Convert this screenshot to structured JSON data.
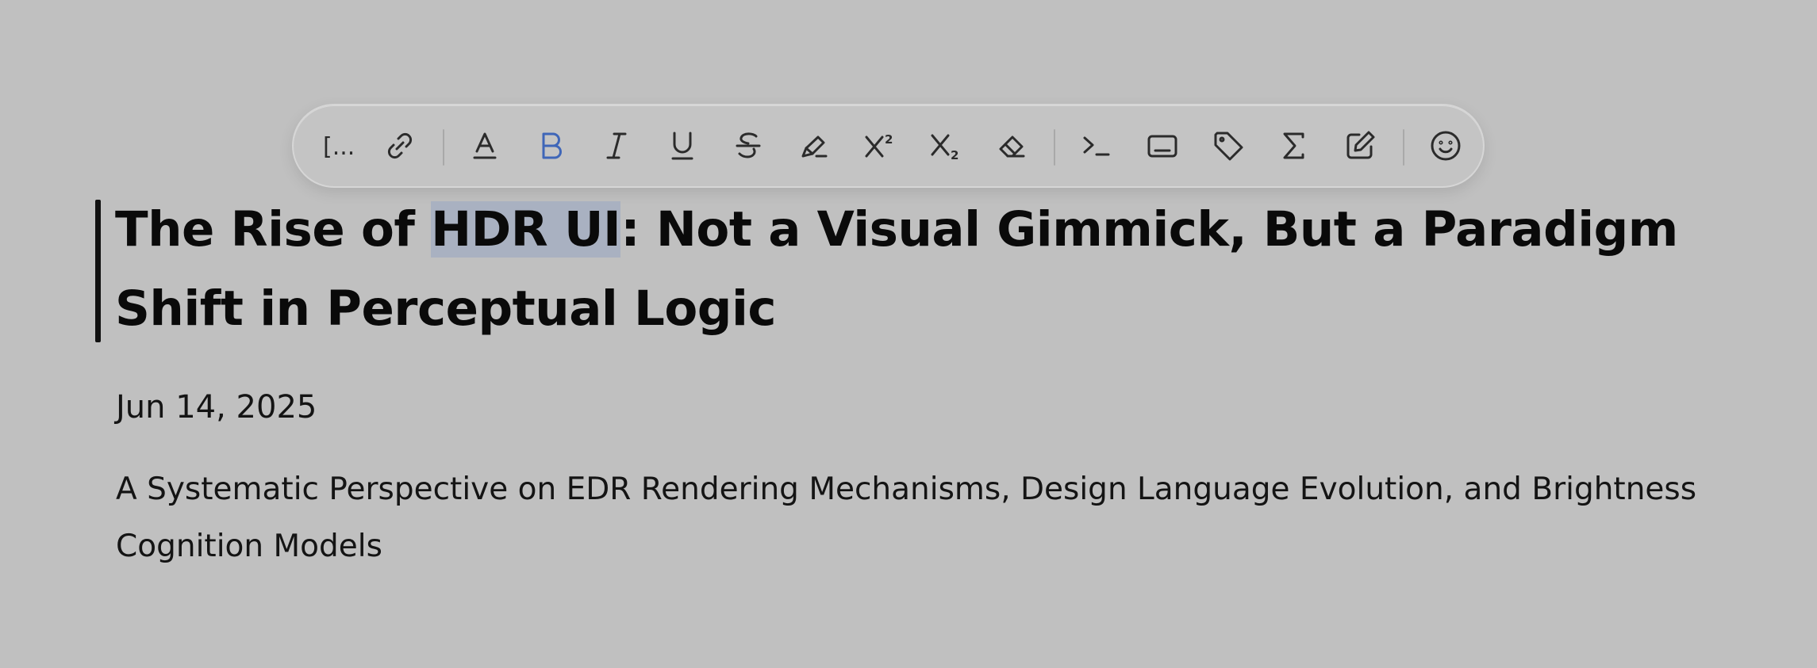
{
  "toolbar": {
    "items": [
      {
        "name": "reference-icon",
        "label": "[..."
      },
      {
        "name": "link-icon"
      },
      {
        "name": "text-color-icon"
      },
      {
        "name": "bold-icon",
        "active": true
      },
      {
        "name": "italic-icon"
      },
      {
        "name": "underline-icon"
      },
      {
        "name": "strikethrough-icon"
      },
      {
        "name": "highlight-icon"
      },
      {
        "name": "superscript-icon"
      },
      {
        "name": "subscript-icon"
      },
      {
        "name": "clear-format-icon"
      },
      {
        "name": "inline-code-icon"
      },
      {
        "name": "keyboard-icon"
      },
      {
        "name": "tag-icon"
      },
      {
        "name": "math-sigma-icon"
      },
      {
        "name": "edit-icon"
      },
      {
        "name": "emoji-icon"
      }
    ],
    "accent_color": "#3f66b8"
  },
  "document": {
    "title_before": "The Rise of ",
    "title_selected": "HDR UI",
    "title_after": ": Not a Visual Gimmick, But a Paradigm Shift in Perceptual Logic",
    "date": "Jun 14, 2025",
    "subtitle": "A Systematic Perspective on EDR Rendering Mechanisms, Design Language Evolution, and Brightness Cognition Models"
  }
}
